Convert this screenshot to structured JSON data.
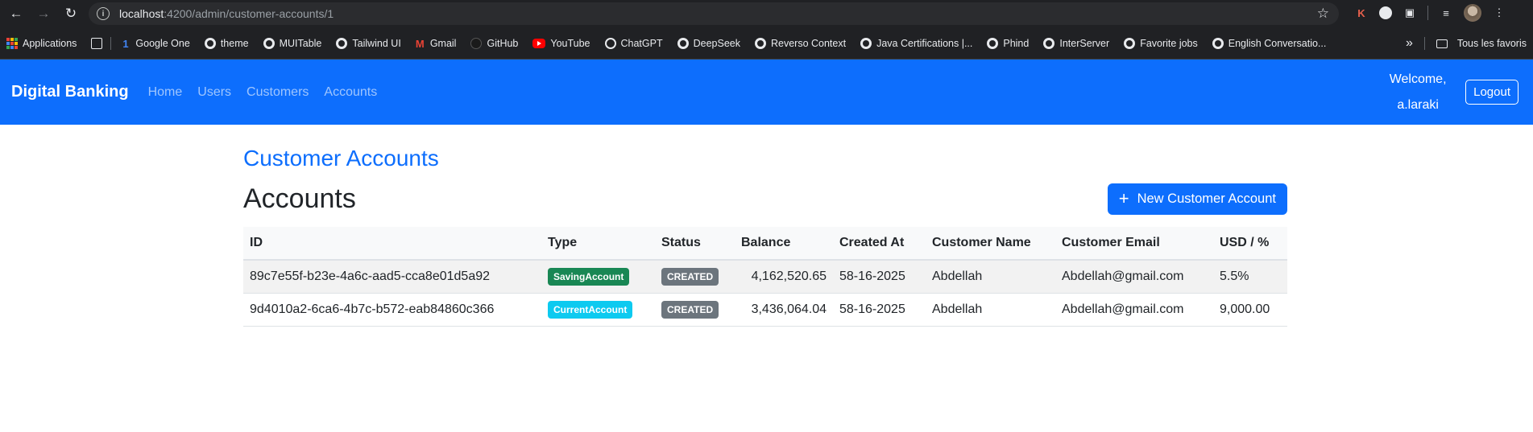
{
  "browser": {
    "url_host": "localhost",
    "url_path": ":4200/admin/customer-accounts/1",
    "bookmarks": [
      {
        "label": "Applications",
        "icon": "apps-grid-icon"
      },
      {
        "label": "",
        "icon": "squares-icon"
      },
      {
        "label": "Google One",
        "icon": "google-one-icon"
      },
      {
        "label": "theme",
        "icon": "globe-icon"
      },
      {
        "label": "MUITable",
        "icon": "globe-icon"
      },
      {
        "label": "Tailwind UI",
        "icon": "globe-icon"
      },
      {
        "label": "Gmail",
        "icon": "gmail-icon"
      },
      {
        "label": "GitHub",
        "icon": "github-icon"
      },
      {
        "label": "YouTube",
        "icon": "youtube-icon"
      },
      {
        "label": "ChatGPT",
        "icon": "chatgpt-icon"
      },
      {
        "label": "DeepSeek",
        "icon": "globe-icon"
      },
      {
        "label": "Reverso Context",
        "icon": "globe-icon"
      },
      {
        "label": "Java Certifications |...",
        "icon": "globe-icon"
      },
      {
        "label": "Phind",
        "icon": "globe-icon"
      },
      {
        "label": "InterServer",
        "icon": "globe-icon"
      },
      {
        "label": "Favorite jobs",
        "icon": "globe-icon"
      },
      {
        "label": "English Conversatio...",
        "icon": "globe-icon"
      }
    ],
    "more_bookmarks": "»",
    "all_bookmarks": "Tous les favoris"
  },
  "navbar": {
    "brand": "Digital Banking",
    "links": [
      "Home",
      "Users",
      "Customers",
      "Accounts"
    ],
    "welcome_line1": "Welcome,",
    "welcome_line2": "a.laraki",
    "logout_label": "Logout",
    "color": "#0d6efd"
  },
  "page": {
    "title": "Customer Accounts",
    "section_title": "Accounts",
    "new_button_label": "New Customer Account"
  },
  "table": {
    "headers": [
      "ID",
      "Type",
      "Status",
      "Balance",
      "Created At",
      "Customer Name",
      "Customer Email",
      "USD / %"
    ],
    "rows": [
      {
        "id": "89c7e55f-b23e-4a6c-aad5-cca8e01d5a92",
        "type": "SavingAccount",
        "type_color": "#198754",
        "status": "CREATED",
        "status_color": "#6c757d",
        "balance": "4,162,520.65",
        "created_at": "58-16-2025",
        "customer_name": "Abdellah",
        "customer_email": "Abdellah@gmail.com",
        "usd_pct": "5.5%"
      },
      {
        "id": "9d4010a2-6ca6-4b7c-b572-eab84860c366",
        "type": "CurrentAccount",
        "type_color": "#0dcaf0",
        "status": "CREATED",
        "status_color": "#6c757d",
        "balance": "3,436,064.04",
        "created_at": "58-16-2025",
        "customer_name": "Abdellah",
        "customer_email": "Abdellah@gmail.com",
        "usd_pct": "9,000.00"
      }
    ]
  }
}
